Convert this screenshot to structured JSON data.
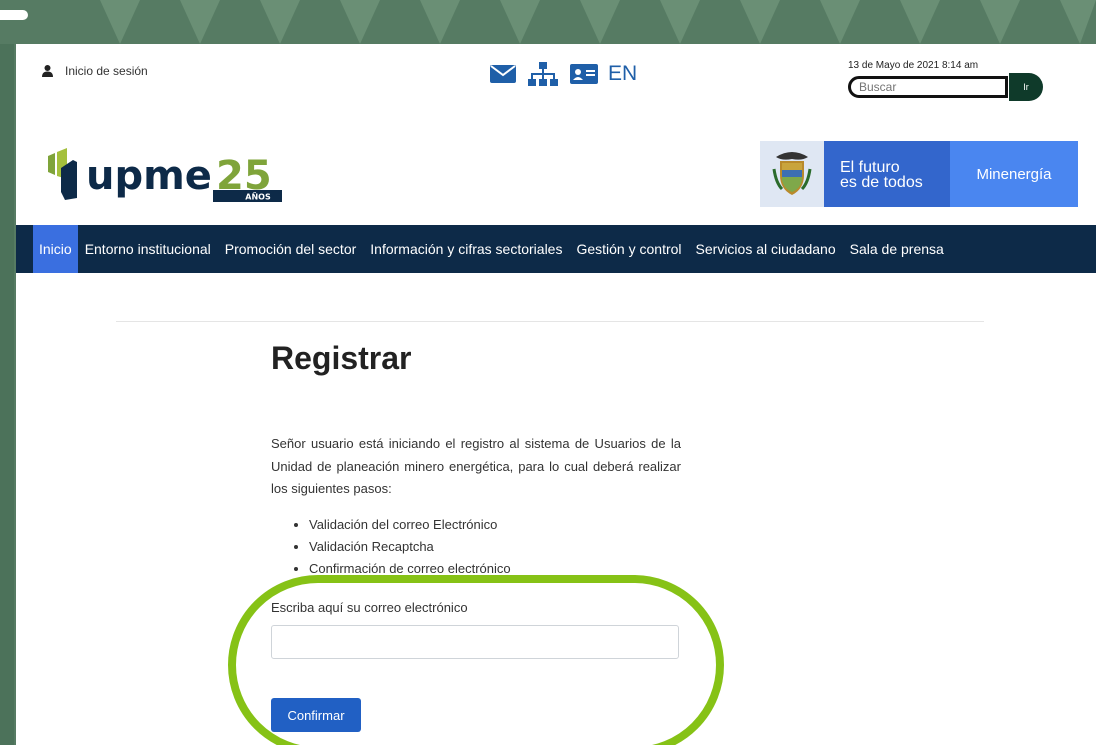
{
  "header": {
    "login_label": "Inicio de sesión",
    "lang_label": "EN",
    "date": "13 de Mayo de 2021 8:14 am",
    "search_placeholder": "Buscar",
    "search_button": "Ir"
  },
  "logo": {
    "text": "upme",
    "number": "25",
    "subtitle": "AÑOS"
  },
  "gov": {
    "futuro_line1": "El futuro",
    "futuro_line2": "es de todos",
    "ministry": "Minenergía"
  },
  "nav": {
    "items": [
      "Inicio",
      "Entorno institucional",
      "Promoción del sector",
      "Información y cifras sectoriales",
      "Gestión y control",
      "Servicios al ciudadano",
      "Sala de prensa"
    ]
  },
  "register": {
    "title": "Registrar",
    "description": "Señor usuario está iniciando el registro al sistema de Usuarios de la Unidad de planeación minero energética, para lo cual deberá realizar los siguientes pasos:",
    "steps": [
      "Validación del correo Electrónico",
      "Validación Recaptcha",
      "Confirmación de correo electrónico"
    ],
    "email_label": "Escriba aquí su correo electrónico",
    "email_value": "",
    "confirm_label": "Confirmar"
  },
  "colors": {
    "background": "#567b63",
    "nav": "#0d2a48",
    "nav_active": "#3a6fe0",
    "button": "#2160c4",
    "highlight": "#86c216",
    "logo_green": "#7fa43a",
    "logo_navy": "#0d2a48"
  }
}
